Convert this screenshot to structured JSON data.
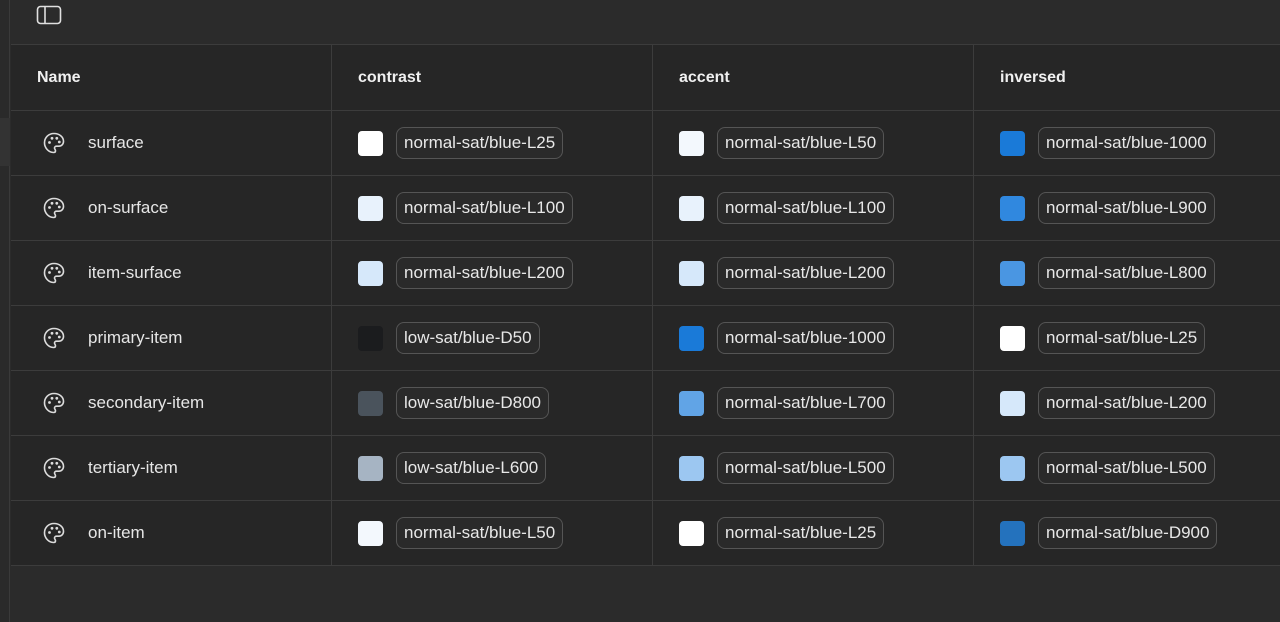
{
  "table": {
    "headers": [
      "Name",
      "contrast",
      "accent",
      "inversed"
    ],
    "rows": [
      {
        "name": "surface",
        "contrast": {
          "token": "normal-sat/blue-L25",
          "color": "#ffffff"
        },
        "accent": {
          "token": "normal-sat/blue-L50",
          "color": "#f3f8fd"
        },
        "inversed": {
          "token": "normal-sat/blue-1000",
          "color": "#1a7ad8"
        }
      },
      {
        "name": "on-surface",
        "contrast": {
          "token": "normal-sat/blue-L100",
          "color": "#e8f2fc"
        },
        "accent": {
          "token": "normal-sat/blue-L100",
          "color": "#e8f2fc"
        },
        "inversed": {
          "token": "normal-sat/blue-L900",
          "color": "#3088df"
        }
      },
      {
        "name": "item-surface",
        "contrast": {
          "token": "normal-sat/blue-L200",
          "color": "#d6e8fa"
        },
        "accent": {
          "token": "normal-sat/blue-L200",
          "color": "#d6e8fa"
        },
        "inversed": {
          "token": "normal-sat/blue-L800",
          "color": "#4a96e2"
        }
      },
      {
        "name": "primary-item",
        "contrast": {
          "token": "low-sat/blue-D50",
          "color": "#1b1c1e"
        },
        "accent": {
          "token": "normal-sat/blue-1000",
          "color": "#1a7ad8"
        },
        "inversed": {
          "token": "normal-sat/blue-L25",
          "color": "#ffffff"
        }
      },
      {
        "name": "secondary-item",
        "contrast": {
          "token": "low-sat/blue-D800",
          "color": "#4a535c"
        },
        "accent": {
          "token": "normal-sat/blue-L700",
          "color": "#61a4e6"
        },
        "inversed": {
          "token": "normal-sat/blue-L200",
          "color": "#d6e8fa"
        }
      },
      {
        "name": "tertiary-item",
        "contrast": {
          "token": "low-sat/blue-L600",
          "color": "#a6b4c3"
        },
        "accent": {
          "token": "normal-sat/blue-L500",
          "color": "#9cc7f1"
        },
        "inversed": {
          "token": "normal-sat/blue-L500",
          "color": "#9cc7f1"
        }
      },
      {
        "name": "on-item",
        "contrast": {
          "token": "normal-sat/blue-L50",
          "color": "#f3f8fd"
        },
        "accent": {
          "token": "normal-sat/blue-L25",
          "color": "#ffffff"
        },
        "inversed": {
          "token": "normal-sat/blue-D900",
          "color": "#2472bd"
        }
      }
    ]
  },
  "icons": {
    "toolbar": "sidebar-toggle-icon",
    "row": "palette-icon"
  }
}
